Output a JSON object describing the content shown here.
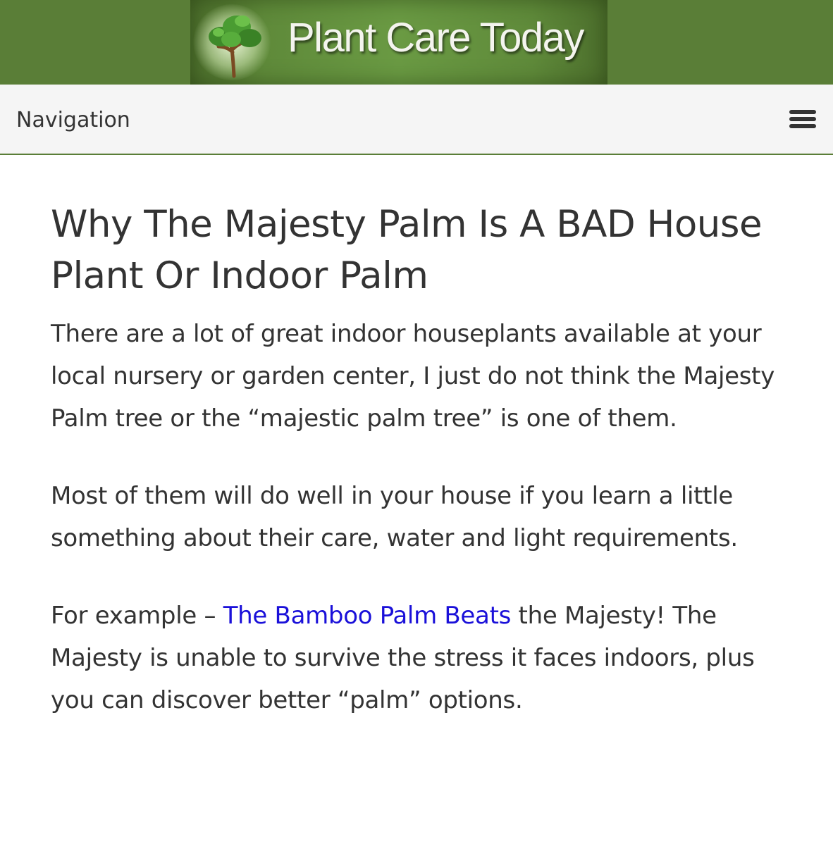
{
  "header": {
    "site_name": "Plant Care Today",
    "logo_icon": "tree-icon",
    "background_color": "#5a7e37"
  },
  "navbar": {
    "label": "Navigation",
    "menu_icon": "hamburger-menu-icon"
  },
  "article": {
    "title": "Why The Majesty Palm Is A BAD House Plant Or Indoor Palm",
    "paragraphs": [
      {
        "text": "There are a lot of great indoor houseplants available at your local nursery or garden center, I just do not think the Majesty Palm tree or the “majestic palm tree” is one of them."
      },
      {
        "text": "Most of them will do well in your house if you learn a little something about their care, water and light requirements."
      },
      {
        "before_link": "For example – ",
        "link_text": "The Bamboo Palm Beats",
        "after_link": " the Majesty! The Majesty is unable to survive the stress it faces indoors, plus you can discover better “palm” options."
      }
    ],
    "link_color": "#1a10d9"
  }
}
